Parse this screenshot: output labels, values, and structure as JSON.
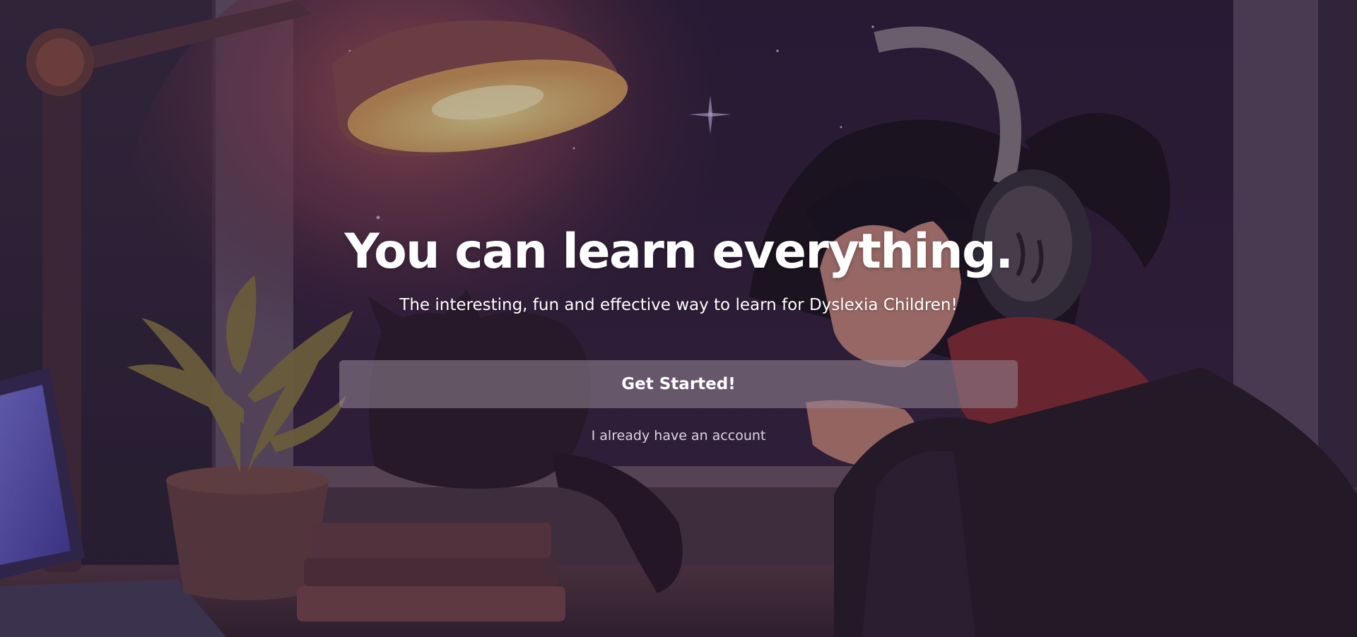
{
  "hero": {
    "headline": "You can learn everything.",
    "subtitle": "The interesting, fun and effective way to learn for Dyslexia Children!",
    "cta_label": "Get Started!",
    "login_label": "I already have an account"
  },
  "background": {
    "scene": "lofi-study-room-illustration",
    "elements": [
      "desk-lamp-icon",
      "plant-icon",
      "cat-silhouette",
      "girl-with-headphones",
      "window-night-sky",
      "laptop-screen",
      "books"
    ]
  },
  "colors": {
    "text": "#ffffff",
    "button_bg": "rgba(150,135,150,0.55)",
    "overlay": "rgba(20,14,30,0.28)"
  }
}
